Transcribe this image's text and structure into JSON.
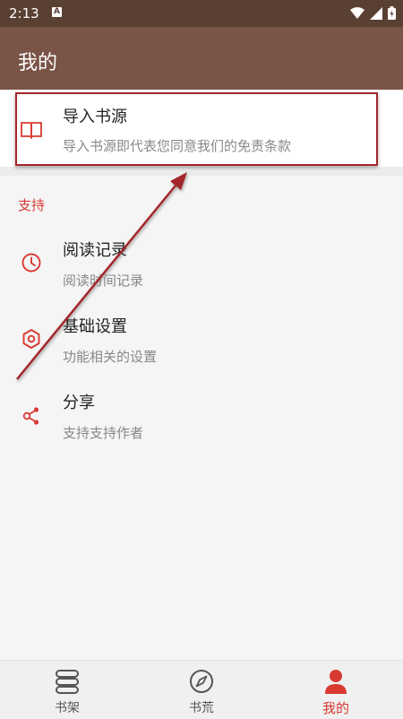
{
  "status_bar": {
    "time": "2:13",
    "notification_letter": "A"
  },
  "app_bar": {
    "title": "我的"
  },
  "import_source": {
    "title": "导入书源",
    "subtitle": "导入书源即代表您同意我们的免责条款"
  },
  "support_section": {
    "heading": "支持",
    "items": [
      {
        "title": "阅读记录",
        "subtitle": "阅读时间记录",
        "icon": "clock-icon"
      },
      {
        "title": "基础设置",
        "subtitle": "功能相关的设置",
        "icon": "settings-icon"
      },
      {
        "title": "分享",
        "subtitle": "支持支持作者",
        "icon": "share-icon"
      }
    ]
  },
  "bottom_nav": {
    "items": [
      {
        "label": "书架",
        "icon": "bookshelf-icon",
        "active": false
      },
      {
        "label": "书荒",
        "icon": "compass-icon",
        "active": false
      },
      {
        "label": "我的",
        "icon": "person-icon",
        "active": true
      }
    ]
  },
  "colors": {
    "accent": "#d83a32",
    "app_bar": "#7a5446",
    "status_bar": "#5a3f33",
    "annotation": "#a3262a"
  }
}
